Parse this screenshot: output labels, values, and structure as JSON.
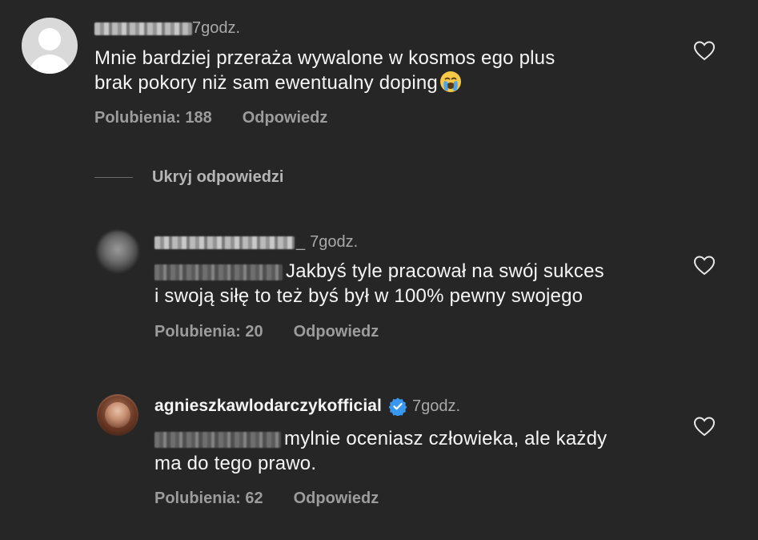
{
  "comments": [
    {
      "time": "7godz.",
      "text_lines": [
        "Mnie bardziej przeraża wywalone w kosmos ego plus",
        "brak pokory niż sam ewentualny doping"
      ],
      "likes": "Polubienia: 188",
      "reply": "Odpowiedz"
    },
    {
      "time": "7godz.",
      "username_tail": "_",
      "text_lines": [
        "Jakbyś tyle pracował na swój sukces",
        "i swoją siłę to też byś był w 100% pewny swojego"
      ],
      "likes": "Polubienia: 20",
      "reply": "Odpowiedz"
    },
    {
      "username": "agnieszkawlodarczykofficial",
      "time": "7godz.",
      "text_lines": [
        "mylnie oceniasz człowieka, ale każdy",
        "ma do tego prawo."
      ],
      "likes": "Polubienia: 62",
      "reply": "Odpowiedz"
    }
  ],
  "hide_replies_label": "Ukryj odpowiedzi",
  "icons": {
    "like": "heart-outline-icon",
    "verified": "verified-badge-icon",
    "emoji": "loudly-crying-face-emoji"
  },
  "colors": {
    "background": "#262626",
    "text": "#f5f5f5",
    "muted": "#a8a8a8",
    "verified": "#3897f0"
  }
}
